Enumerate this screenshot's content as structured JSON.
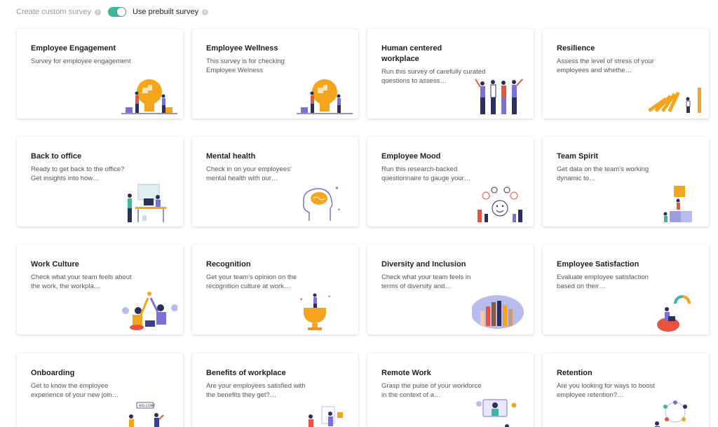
{
  "topbar": {
    "custom_label": "Create custom survey",
    "prebuilt_label": "Use prebuilt survey",
    "toggle_state": "prebuilt"
  },
  "cards": [
    {
      "title": "Employee Engagement",
      "desc": "Survey for employee engagement",
      "icon": "puzzle-head-illustration"
    },
    {
      "title": "Employee Wellness",
      "desc": "This survey is for checking Employee Welness",
      "icon": "puzzle-head-illustration"
    },
    {
      "title": "Human centered workplace",
      "desc": "Run this survey of carefully curated questions to assess…",
      "icon": "team-cheering-illustration"
    },
    {
      "title": "Resilience",
      "desc": "Assess the level of stress of your employees and whethe…",
      "icon": "domino-illustration"
    },
    {
      "title": "Back to office",
      "desc": "Ready to get back to the office? Get insights into how…",
      "icon": "office-desk-illustration"
    },
    {
      "title": "Mental health",
      "desc": "Check in on your employees' mental health with our…",
      "icon": "brain-head-illustration"
    },
    {
      "title": "Employee Mood",
      "desc": "Run this research-backed questionnaire to gauge your…",
      "icon": "mood-faces-illustration"
    },
    {
      "title": "Team Spirit",
      "desc": "Get data on the team's working dynamic to…",
      "icon": "puzzle-tower-illustration"
    },
    {
      "title": "Work Culture",
      "desc": "Check what your team feels about the work, the workpla…",
      "icon": "high-five-illustration"
    },
    {
      "title": "Recognition",
      "desc": "Get your team's opinion on the recognition culture at work…",
      "icon": "trophy-illustration"
    },
    {
      "title": "Diversity and Inclusion",
      "desc": "Check what your team feels in terms of diversity and…",
      "icon": "raised-hands-illustration"
    },
    {
      "title": "Employee Satisfaction",
      "desc": "Evaluate employee satisfaction based on their…",
      "icon": "gauge-illustration"
    },
    {
      "title": "Onboarding",
      "desc": "Get to know the employee experience of your new join…",
      "icon": "welcome-illustration"
    },
    {
      "title": "Benefits of workplace",
      "desc": "Are your employees satisfied with the benefits they get?…",
      "icon": "benefits-illustration"
    },
    {
      "title": "Remote Work",
      "desc": "Grasp the pulse of your workforce in the context of a…",
      "icon": "video-call-illustration"
    },
    {
      "title": "Retention",
      "desc": "Are you looking for ways to boost employee retention?…",
      "icon": "network-illustration"
    }
  ],
  "colors": {
    "accent": "#3fb59c",
    "illustration_orange": "#f4a51c",
    "illustration_purple": "#7b6fd8",
    "illustration_navy": "#2b2f5c",
    "illustration_red": "#e8533f"
  }
}
